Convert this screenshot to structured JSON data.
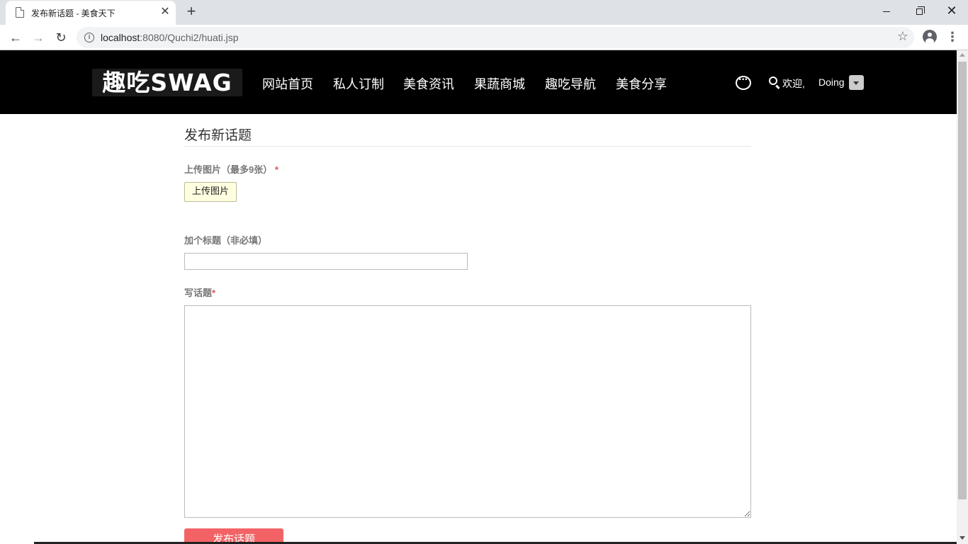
{
  "browser": {
    "tab_title": "发布新话题 - 美食天下",
    "tab_close": "✕",
    "new_tab": "+",
    "url_host": "localhost",
    "url_rest": ":8080/Quchi2/huati.jsp",
    "win_close": "✕"
  },
  "header": {
    "logo_text": "趣吃SWAG",
    "nav": [
      "网站首页",
      "私人订制",
      "美食资讯",
      "果蔬商城",
      "趣吃导航",
      "美食分享"
    ],
    "welcome": "欢迎,",
    "username": "Doing"
  },
  "form": {
    "page_title": "发布新话题",
    "upload_label": "上传图片（最多9张）",
    "upload_required": "*",
    "upload_button": "上传图片",
    "title_label": "加个标题（非必填）",
    "title_value": "",
    "topic_label": "写话题",
    "topic_required": "*",
    "topic_value": "",
    "submit_button": "发布话题"
  },
  "colors": {
    "header_bg": "#000000",
    "submit_bg": "#f36366",
    "upload_bg": "#ffffe0",
    "required": "#d9534f"
  }
}
